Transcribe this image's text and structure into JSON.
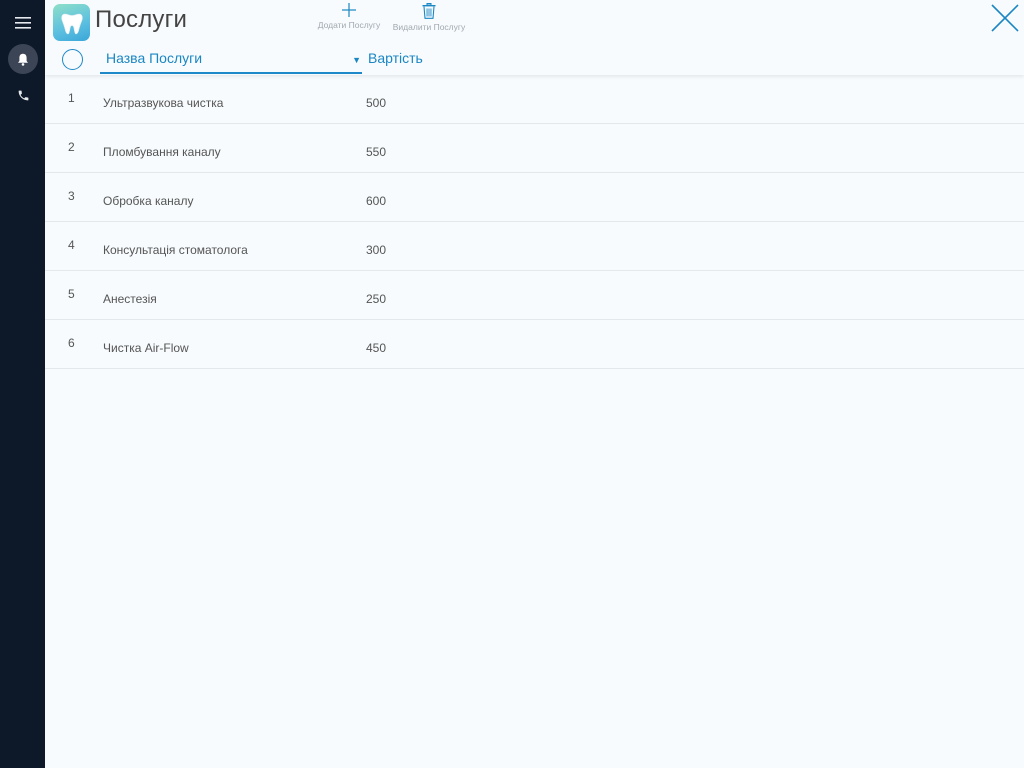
{
  "header": {
    "title": "Послуги",
    "add_label": "Додати Послугу",
    "delete_label": "Видалити Послугу"
  },
  "table": {
    "columns": {
      "name": "Назва Послуги",
      "price": "Вартість"
    },
    "sort_indicator": "▼",
    "rows": [
      {
        "num": "1",
        "name": "Ультразвукова чистка",
        "price": "500"
      },
      {
        "num": "2",
        "name": "Пломбування каналу",
        "price": "550"
      },
      {
        "num": "3",
        "name": "Обробка каналу",
        "price": "600"
      },
      {
        "num": "4",
        "name": "Консультація стоматолога",
        "price": "300"
      },
      {
        "num": "5",
        "name": "Анестезія",
        "price": "250"
      },
      {
        "num": "6",
        "name": "Чистка Air-Flow",
        "price": "450"
      }
    ]
  },
  "sidebar": {
    "icons": [
      "menu-icon",
      "bell-icon",
      "phone-icon"
    ]
  },
  "colors": {
    "accent": "#1a86c4",
    "sidebar_bg": "#0d1828",
    "page_bg": "#f7fbfd"
  }
}
